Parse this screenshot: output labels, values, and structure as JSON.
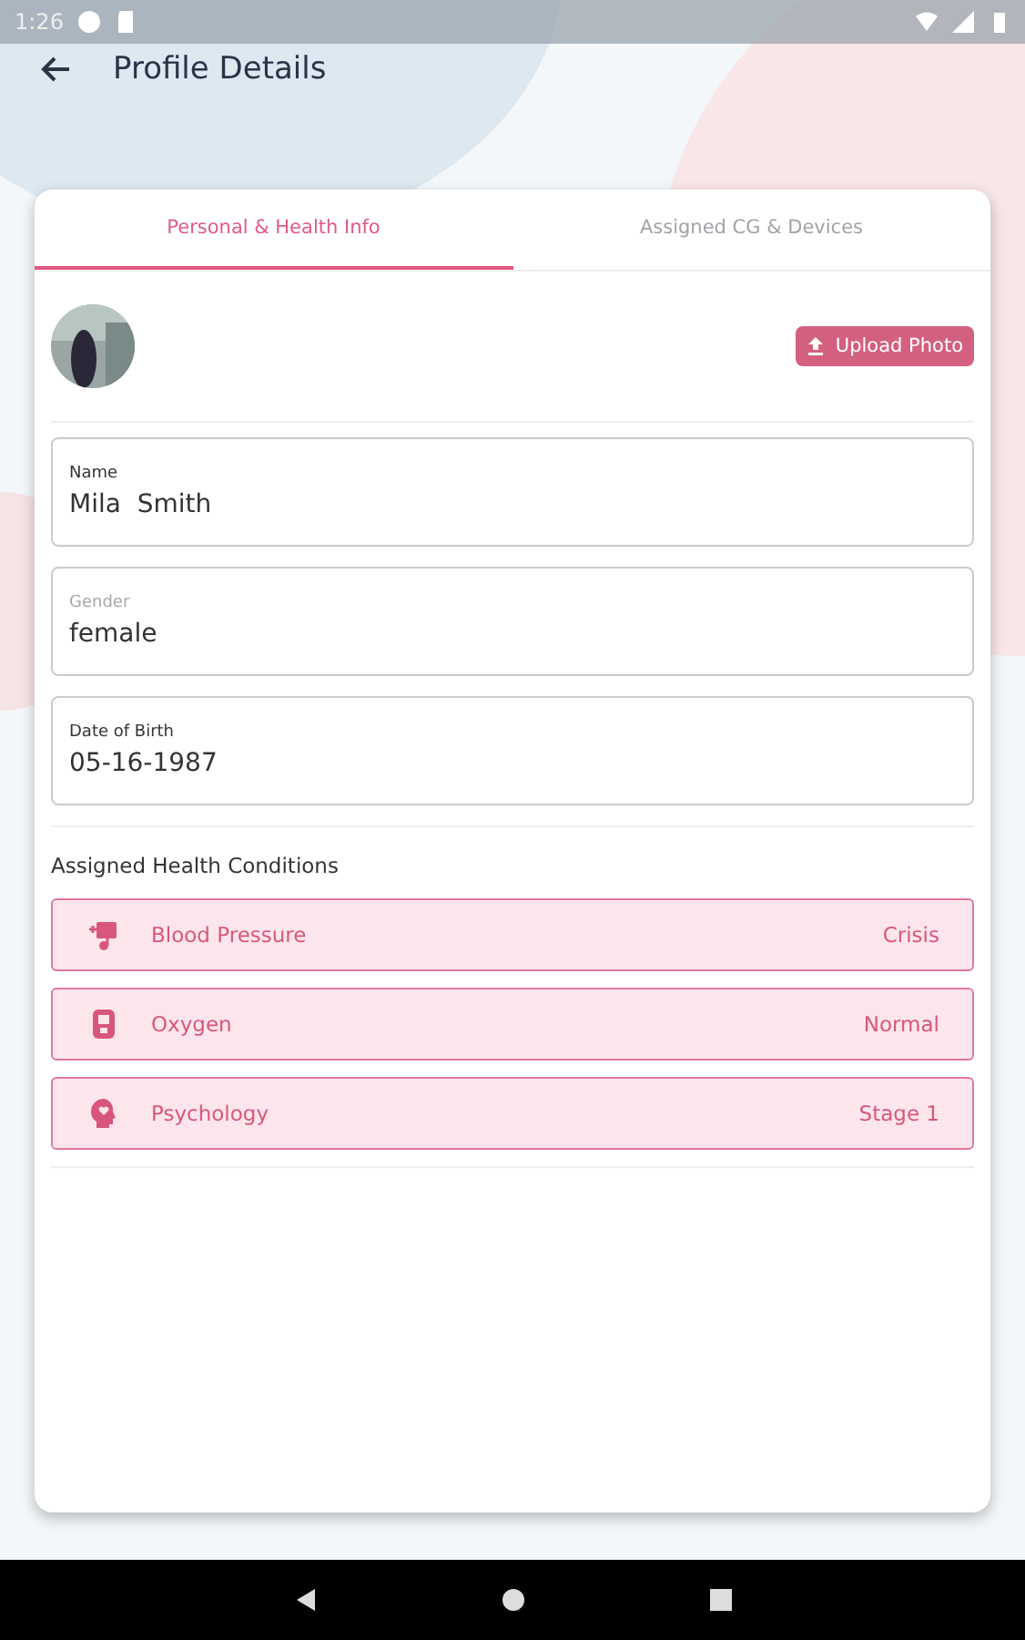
{
  "status_bar": {
    "time": "1:26"
  },
  "header": {
    "title": "Profile Details"
  },
  "tabs": [
    {
      "label": "Personal & Health Info",
      "selected": true
    },
    {
      "label": "Assigned CG & Devices",
      "selected": false
    }
  ],
  "photo": {
    "button": "Upload Photo"
  },
  "fields": [
    {
      "label": "Name",
      "value": "Mila  Smith",
      "disabled": false
    },
    {
      "label": "Gender",
      "value": "female",
      "disabled": true
    },
    {
      "label": "Date of Birth",
      "value": "05-16-1987",
      "disabled": false
    }
  ],
  "conditions_title": "Assigned Health Conditions",
  "conditions": [
    {
      "kind": "blood-pressure",
      "name": "Blood Pressure",
      "status": "Crisis"
    },
    {
      "kind": "oxygen",
      "name": "Oxygen",
      "status": "Normal"
    },
    {
      "kind": "psychology",
      "name": "Psychology",
      "status": "Stage 1"
    }
  ]
}
